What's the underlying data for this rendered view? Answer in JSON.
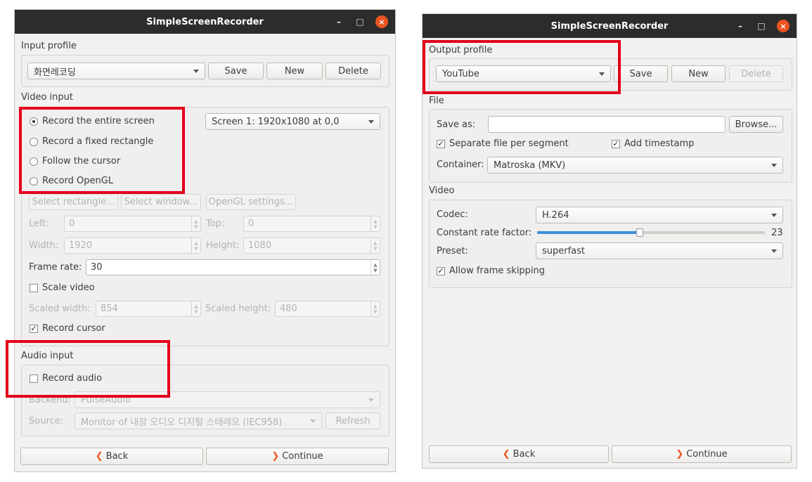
{
  "left": {
    "title": "SimpleScreenRecorder",
    "window_controls": {
      "minimize": "–",
      "maximize": "□",
      "close": "×"
    },
    "input_profile": {
      "heading": "Input profile",
      "selected": "화면레코딩",
      "save": "Save",
      "new": "New",
      "delete": "Delete"
    },
    "video_input": {
      "heading": "Video input",
      "options": [
        "Record the entire screen",
        "Record a fixed rectangle",
        "Follow the cursor",
        "Record OpenGL"
      ],
      "selected_option": 0,
      "screen": "Screen 1: 1920x1080 at 0,0",
      "select_rectangle": "Select rectangle...",
      "select_window": "Select window...",
      "opengl_settings": "OpenGL settings...",
      "left_label": "Left:",
      "left_value": "0",
      "top_label": "Top:",
      "top_value": "0",
      "width_label": "Width:",
      "width_value": "1920",
      "height_label": "Height:",
      "height_value": "1080",
      "frame_rate_label": "Frame rate:",
      "frame_rate_value": "30",
      "scale_video": "Scale video",
      "scaled_width_label": "Scaled width:",
      "scaled_width_value": "854",
      "scaled_height_label": "Scaled height:",
      "scaled_height_value": "480",
      "record_cursor": "Record cursor"
    },
    "audio_input": {
      "heading": "Audio input",
      "record_audio": "Record audio",
      "backend_label": "Backend:",
      "backend_value": "PulseAudio",
      "source_label": "Source:",
      "source_value": "Monitor of 내장 오디오 디지털 스테레오 (IEC958)",
      "refresh": "Refresh"
    },
    "back": "Back",
    "continue": "Continue"
  },
  "right": {
    "title": "SimpleScreenRecorder",
    "window_controls": {
      "minimize": "–",
      "maximize": "□",
      "close": "×"
    },
    "output_profile": {
      "heading": "Output profile",
      "selected": "YouTube",
      "save": "Save",
      "new": "New",
      "delete": "Delete"
    },
    "file": {
      "heading": "File",
      "save_as_label": "Save as:",
      "save_as_value": "",
      "browse": "Browse...",
      "separate_file": "Separate file per segment",
      "add_timestamp": "Add timestamp",
      "container_label": "Container:",
      "container_value": "Matroska (MKV)"
    },
    "video": {
      "heading": "Video",
      "codec_label": "Codec:",
      "codec_value": "H.264",
      "crf_label": "Constant rate factor:",
      "crf_value": "23",
      "crf_min": 0,
      "crf_max": 51,
      "preset_label": "Preset:",
      "preset_value": "superfast",
      "allow_frame_skipping": "Allow frame skipping"
    },
    "back": "Back",
    "continue": "Continue"
  },
  "colors": {
    "highlight_box": "#e3001b",
    "accent": "#e95420",
    "titlebar": "#2c2c2c",
    "slider": "#3c8fd8"
  }
}
